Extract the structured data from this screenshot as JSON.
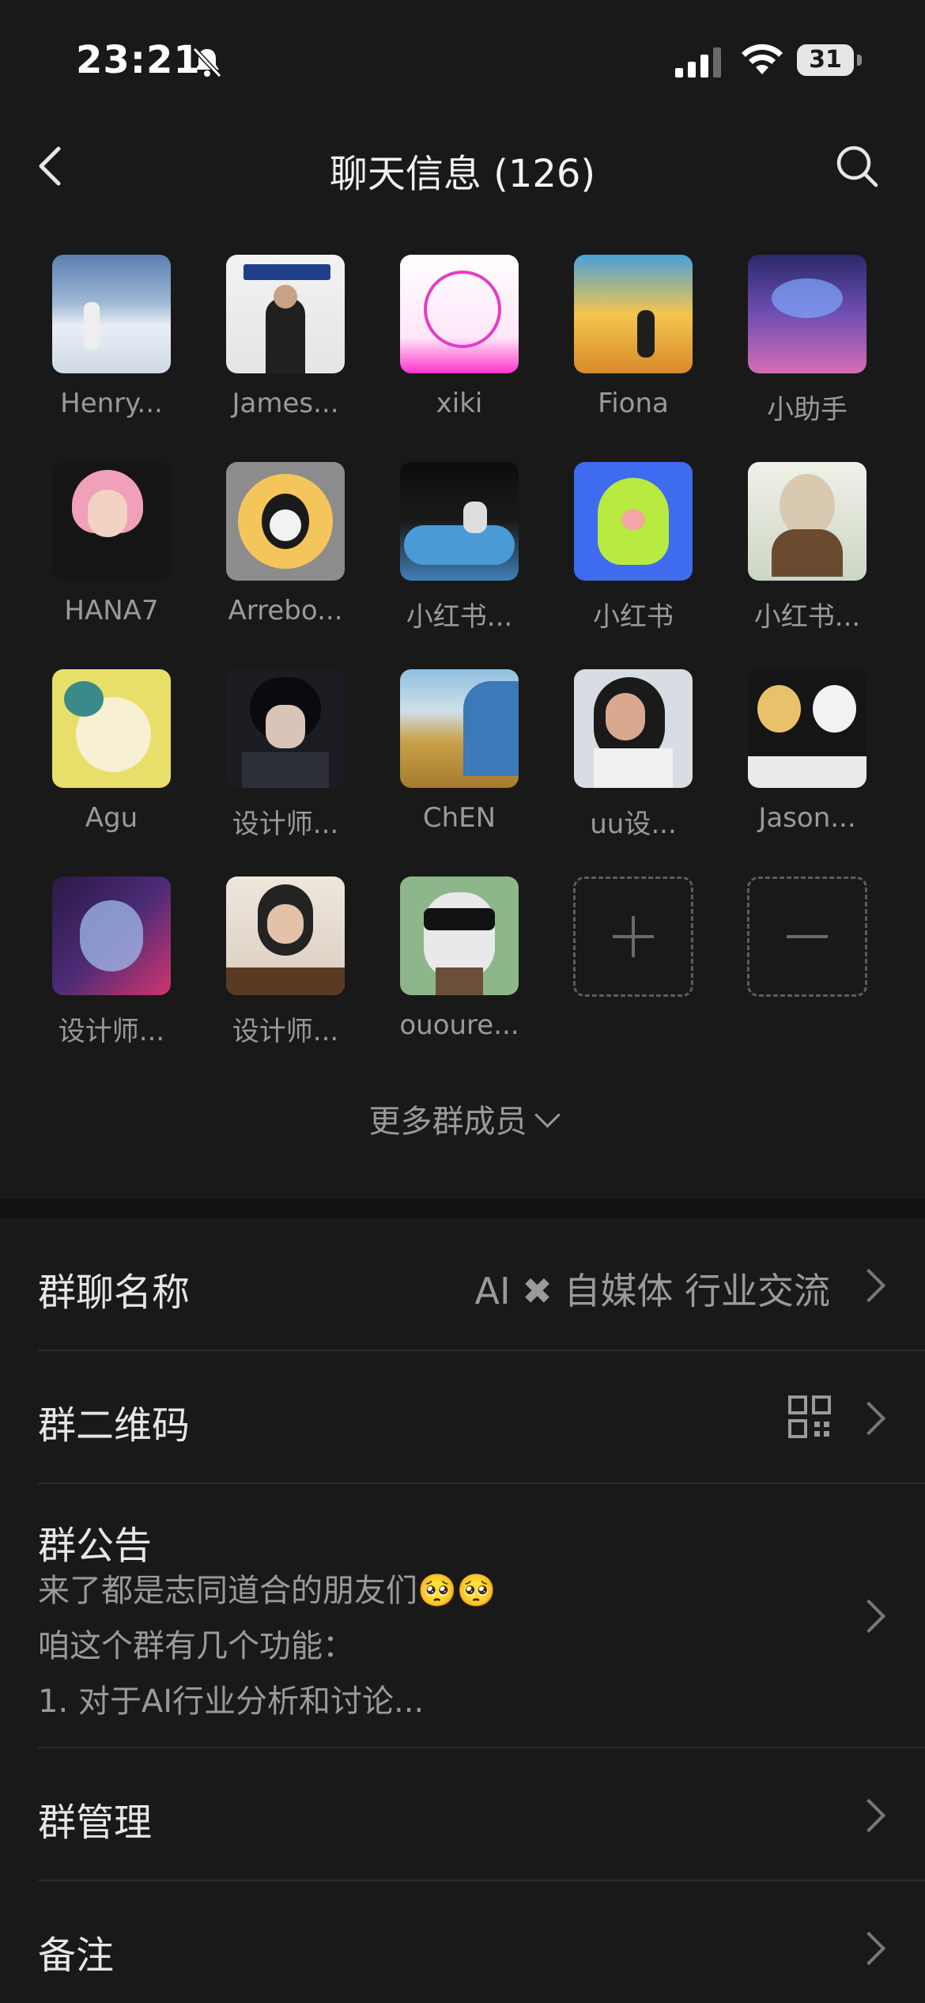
{
  "status_bar": {
    "time": "23:21",
    "battery": "31"
  },
  "header": {
    "title": "聊天信息 (126)"
  },
  "members": [
    {
      "name": "Henry..."
    },
    {
      "name": "James..."
    },
    {
      "name": "xiki"
    },
    {
      "name": "Fiona"
    },
    {
      "name": "小助手"
    },
    {
      "name": "HANA7"
    },
    {
      "name": "Arrebo..."
    },
    {
      "name": "小红书..."
    },
    {
      "name": "小红书"
    },
    {
      "name": "小红书..."
    },
    {
      "name": "Agu"
    },
    {
      "name": "设计师..."
    },
    {
      "name": "ChEN"
    },
    {
      "name": "uu设..."
    },
    {
      "name": "Jason..."
    },
    {
      "name": "设计师..."
    },
    {
      "name": "设计师..."
    },
    {
      "name": "ououre..."
    }
  ],
  "more_members": "更多群成员",
  "settings": {
    "group_name": {
      "label": "群聊名称",
      "value": "AI ✖ 自媒体 行业交流"
    },
    "qr_code": {
      "label": "群二维码"
    },
    "notice": {
      "label": "群公告",
      "line1": "来了都是志同道合的朋友们🥺🥺",
      "line2": "咱这个群有几个功能：",
      "line3": "1. 对于AI行业分析和讨论..."
    },
    "manage": {
      "label": "群管理"
    },
    "remark": {
      "label": "备注"
    }
  },
  "colors": {
    "background": "#111111",
    "panel": "#191919",
    "text": "#e6e6e6",
    "muted": "#9a9a9a"
  }
}
